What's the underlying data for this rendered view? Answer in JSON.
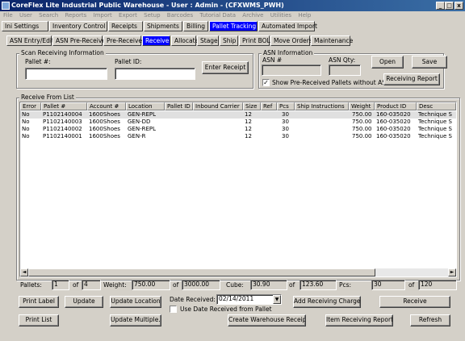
{
  "window": {
    "title": "CoreFlex Lite Industrial Public Warehouse - User : Admin - (CFXWMS_PWH)",
    "btn_min": "_",
    "btn_max": "□",
    "btn_close": "x"
  },
  "menu": [
    "File",
    "User",
    "Search",
    "Reports",
    "Import",
    "Export",
    "Setup",
    "Barcodes",
    "Tutorial Data",
    "Archive",
    "Utilities",
    "Help"
  ],
  "main_tabs": [
    "Ini Settings",
    "Inventory Control",
    "Receipts",
    "Shipments",
    "Billing",
    "Pallet Tracking",
    "Automated Import"
  ],
  "sub_tabs": [
    "ASN Entry/Edit",
    "ASN Pre-Receive",
    "Pre-Receive",
    "Receive",
    "Allocate",
    "Stage",
    "Ship",
    "Print BOL",
    "Move Orders",
    "Maintenance"
  ],
  "scan": {
    "title": "Scan Receiving Information",
    "pallet_label": "Pallet #:",
    "pallet_value": "",
    "pallet_id_label": "Pallet ID:",
    "pallet_id_value": "",
    "enter_receipt": "Enter Receipt"
  },
  "asn": {
    "title": "ASN Information",
    "asn_label": "ASN #",
    "asn_value": "",
    "qty_label": "ASN Qty:",
    "qty_value": "",
    "open": "Open",
    "save": "Save",
    "show_prereceived": "Show Pre-Received Pallets without ASN",
    "show_prereceived_checked": "✓",
    "receiving_report": "Receiving Report"
  },
  "list": {
    "title": "Receive From List",
    "columns": [
      "Error",
      "Pallet #",
      "Account #",
      "Location",
      "Pallet ID",
      "Inbound Carrier",
      "Size",
      "Ref",
      "Pcs",
      "Ship Instructions",
      "Weight",
      "Product ID",
      "Desc"
    ],
    "rows": [
      [
        "No",
        "P1102140004",
        "1600Shoes",
        "GEN-REPL",
        "",
        "",
        "12",
        "",
        "30",
        "",
        "750.00",
        "160-035020",
        "Technique S"
      ],
      [
        "No",
        "P1102140003",
        "1600Shoes",
        "GEN-DD",
        "",
        "",
        "12",
        "",
        "30",
        "",
        "750.00",
        "160-035020",
        "Technique S"
      ],
      [
        "No",
        "P1102140002",
        "1600Shoes",
        "GEN-REPL",
        "",
        "",
        "12",
        "",
        "30",
        "",
        "750.00",
        "160-035020",
        "Technique S"
      ],
      [
        "No",
        "P1102140001",
        "1600Shoes",
        "GEN-R",
        "",
        "",
        "12",
        "",
        "30",
        "",
        "750.00",
        "160-035020",
        "Technique S"
      ]
    ],
    "scroll_left": "◄",
    "scroll_right": "►"
  },
  "totals": {
    "pallets_label": "Pallets:",
    "pallets_value": "1",
    "pallets_of": "of",
    "pallets_total": "4",
    "weight_label": "Weight:",
    "weight_value": "750.00",
    "weight_of": "of",
    "weight_total": "3000.00",
    "cube_label": "Cube:",
    "cube_value": "30.90",
    "cube_of": "of",
    "cube_total": "123.60",
    "pcs_label": "Pcs:",
    "pcs_value": "30",
    "pcs_of": "of",
    "pcs_total": "120"
  },
  "actions": {
    "print_label": "Print Label",
    "update": "Update",
    "update_location": "Update Location",
    "date_received_label": "Date Received:",
    "date_received_value": "02/14/2011",
    "use_date_label": "Use Date Received from Pallet",
    "add_receiving_charge": "Add Receiving Charge",
    "receive": "Receive",
    "print_list": "Print List",
    "update_multiple": "Update Multiple...",
    "create_warehouse_receipt": "Create Warehouse Receipt",
    "item_receiving_report": "Item Receiving Report",
    "refresh": "Refresh"
  }
}
